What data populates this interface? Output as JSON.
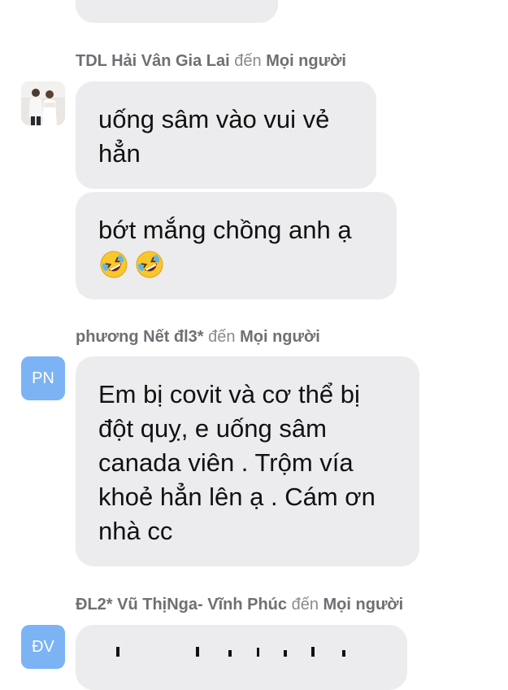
{
  "messages": [
    {
      "sender": "TDL Hải Vân Gia Lai",
      "to_word": "đến",
      "recipient": "Mọi người",
      "avatar_type": "photo",
      "bubbles": [
        "uống sâm vào vui vẻ hẳn",
        "bớt mắng chồng anh ạ"
      ],
      "emojis": [
        "rolling-on-floor-laughing-emoji",
        "rolling-on-floor-laughing-emoji"
      ]
    },
    {
      "sender": "phương Nết đl3*",
      "to_word": "đến",
      "recipient": "Mọi người",
      "avatar_initials": "PN",
      "bubbles": [
        "Em bị covit và cơ thể bị đột quỵ, e uống sâm canada viên . Trộm vía khoẻ hẳn lên ạ . Cám ơn nhà cc"
      ]
    },
    {
      "sender": "ĐL2* Vũ ThịNga- Vĩnh Phúc",
      "to_word": "đến",
      "recipient": "Mọi người",
      "avatar_initials": "ĐV"
    }
  ],
  "colors": {
    "bubble": "#ececee",
    "avatar_initials_bg": "#7bb3f5",
    "sender_text": "#6f6f74"
  }
}
